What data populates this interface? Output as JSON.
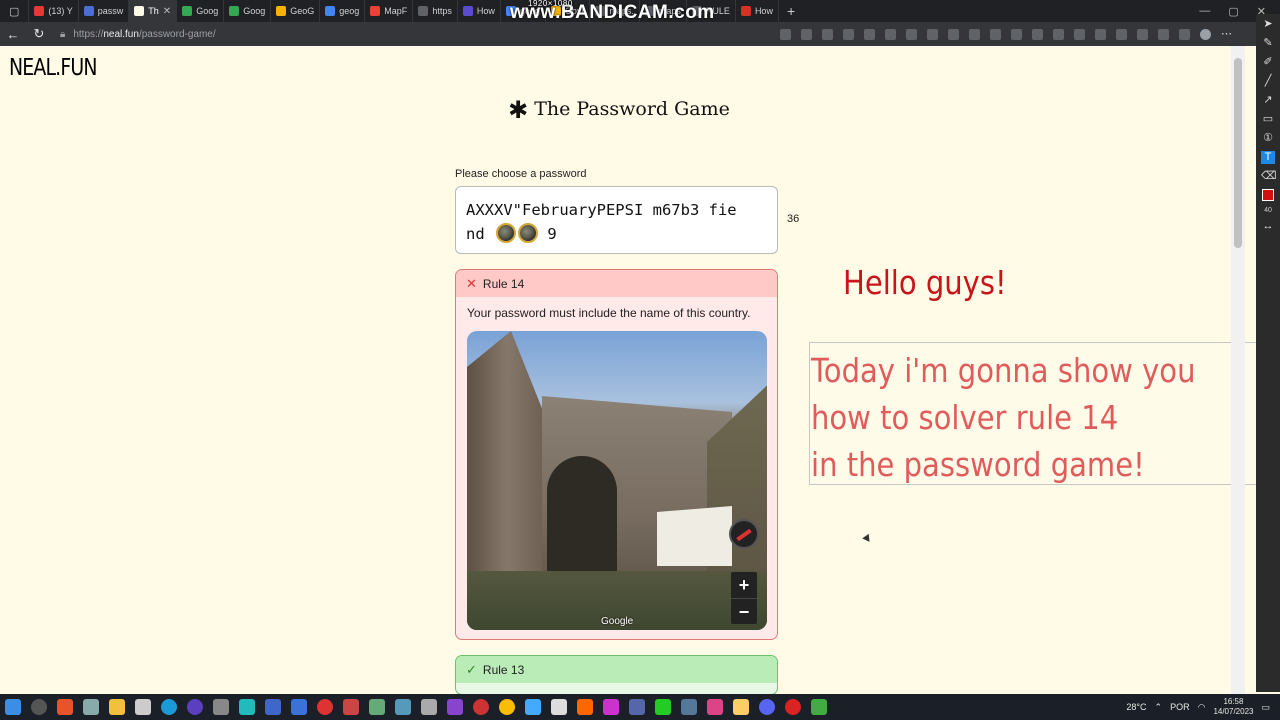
{
  "browser": {
    "tabs": [
      {
        "label": "(13) Y",
        "color": "#e53935"
      },
      {
        "label": "passw",
        "color": "#4a6fd1"
      },
      {
        "label": "Th",
        "color": "#fffbe6",
        "active": true
      },
      {
        "label": "Goog",
        "color": "#34a853"
      },
      {
        "label": "Goog",
        "color": "#34a853"
      },
      {
        "label": "GeoG",
        "color": "#f4b400"
      },
      {
        "label": "geog",
        "color": "#4285f4"
      },
      {
        "label": "MapF",
        "color": "#ea4335"
      },
      {
        "label": "https",
        "color": "#5f6368"
      },
      {
        "label": "How",
        "color": "#5b4bd1"
      },
      {
        "label": "goog",
        "color": "#4285f4"
      },
      {
        "label": "Goyr",
        "color": "#f4b400"
      },
      {
        "label": "maps.",
        "color": "#5f6368"
      },
      {
        "label": "maps",
        "color": "#5f6368"
      },
      {
        "label": "RULE",
        "color": "#5f6368"
      },
      {
        "label": "How",
        "color": "#d93025"
      }
    ],
    "watermark": "www.BANDICAM.com",
    "resolution": "1920×1080",
    "url_prefix": "https://",
    "url_host": "neal.fun",
    "url_path": "/password-game/"
  },
  "page": {
    "site_logo": "NEAL.FUN",
    "title_star": "✱",
    "title": "The Password Game",
    "password_label": "Please choose a password",
    "password_text_1": "AXXXV\"FebruaryPEPSI m67b3 fie",
    "password_text_2": "nd",
    "password_text_3": "9",
    "password_length": "36"
  },
  "rules": {
    "failing": {
      "title": "Rule 14",
      "text": "Your password must include the name of this country.",
      "map_attribution": "Google",
      "zoom_in": "+",
      "zoom_out": "−"
    },
    "passing": {
      "title": "Rule 13"
    }
  },
  "overlay": {
    "hello": "Hello guys!",
    "lines": [
      "Today i'm gonna show you",
      "how to solver rule 14",
      "in the password game!"
    ]
  },
  "taskbar": {
    "temperature": "28°C",
    "language": "POR",
    "time": "16:58",
    "date": "14/07/2023"
  }
}
